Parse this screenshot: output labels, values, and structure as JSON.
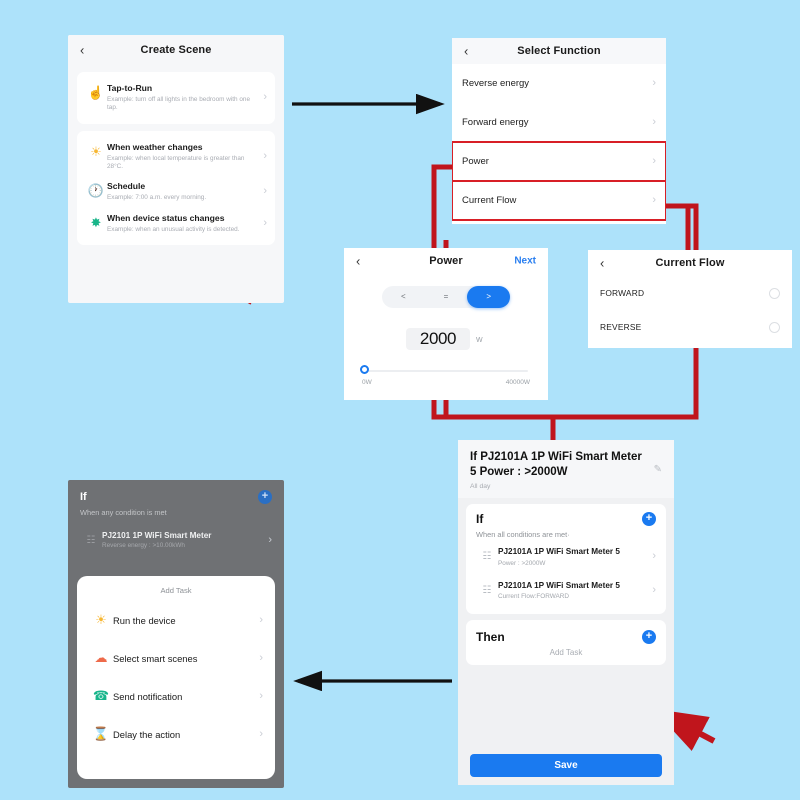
{
  "background_color": "#ade2fa",
  "accent_blue": "#1a7af0",
  "highlight_red": "#d81f26",
  "arrow_black": "#111111",
  "panels": {
    "create_scene": {
      "title": "Create Scene",
      "back_icon": "chevron-left-icon",
      "items": [
        {
          "icon": "tap-hand-icon",
          "glyph": "☝",
          "color": "#e8674a",
          "title": "Tap-to-Run",
          "subtitle": "Example: turn off all lights in the bedroom with one tap."
        },
        {
          "icon": "sun-weather-icon",
          "glyph": "☀",
          "color": "#f7b733",
          "title": "When weather changes",
          "subtitle": "Example: when local temperature is greater than 28°C."
        },
        {
          "icon": "clock-schedule-icon",
          "glyph": "●",
          "color": "#2a7ff0",
          "title": "Schedule",
          "subtitle": "Example: 7:00 a.m. every morning."
        },
        {
          "icon": "device-status-icon",
          "glyph": "●",
          "color": "#19b589",
          "title": "When device status changes",
          "subtitle": "Example: when an unusual activity is detected."
        }
      ]
    },
    "select_function": {
      "title": "Select Function",
      "back_icon": "chevron-left-icon",
      "rows": [
        {
          "label": "Reverse energy",
          "highlighted": false
        },
        {
          "label": "Forward energy",
          "highlighted": false
        },
        {
          "label": "Power",
          "highlighted": true
        },
        {
          "label": "Current Flow",
          "highlighted": true
        }
      ]
    },
    "power": {
      "title": "Power",
      "back_icon": "chevron-left-icon",
      "next_label": "Next",
      "operators": [
        "<",
        "=",
        ">"
      ],
      "selected_operator": ">",
      "value": "2000",
      "unit": "W",
      "slider_min_label": "0W",
      "slider_max_label": "40000W",
      "slider_percent": 5
    },
    "current_flow": {
      "title": "Current Flow",
      "back_icon": "chevron-left-icon",
      "options": [
        {
          "label": "FORWARD",
          "selected": false
        },
        {
          "label": "REVERSE",
          "selected": false
        }
      ]
    },
    "if_summary": {
      "header_title": "If PJ2101A 1P WiFi Smart Meter  5 Power : >2000W",
      "header_sub": "All day",
      "edit_icon": "pencil-icon",
      "if_word": "If",
      "if_condition": "When all conditions are met·",
      "add_icon": "plus-circle-icon",
      "devices": [
        {
          "icon": "smart-meter-icon",
          "name": "PJ2101A 1P WiFi Smart Meter 5",
          "detail": "Power : >2000W"
        },
        {
          "icon": "smart-meter-icon",
          "name": "PJ2101A 1P WiFi Smart Meter 5",
          "detail": "Current Flow:FORWARD"
        }
      ],
      "then_word": "Then",
      "add_task_label": "Add Task",
      "save_label": "Save"
    },
    "add_task": {
      "if_word": "If",
      "if_condition": "When any condition is met",
      "add_icon": "plus-circle-icon",
      "background_device": {
        "icon": "smart-meter-icon",
        "name": "PJ2101 1P WiFi Smart Meter",
        "detail": "Reverse energy : >10.00kWh"
      },
      "sheet_title": "Add Task",
      "options": [
        {
          "icon": "run-device-icon",
          "glyph": "☀",
          "color": "#f7b733",
          "label": "Run the device"
        },
        {
          "icon": "smart-scenes-icon",
          "glyph": "▲",
          "color": "#ee6a4a",
          "label": "Select smart scenes"
        },
        {
          "icon": "notification-icon",
          "glyph": "☎",
          "color": "#18b58b",
          "label": "Send notification"
        },
        {
          "icon": "hourglass-delay-icon",
          "glyph": "⧖",
          "color": "#2a7ff0",
          "label": "Delay the action"
        }
      ]
    }
  },
  "annotations": {
    "flow_arrows": [
      {
        "name": "arrow-create-to-function",
        "direction": "right"
      },
      {
        "name": "arrow-if-summary-to-add-task",
        "direction": "left"
      }
    ],
    "pointer_arrows": [
      {
        "name": "pointer-device-status-changes"
      },
      {
        "name": "pointer-run-the-device"
      },
      {
        "name": "pointer-then-add-button"
      }
    ]
  }
}
